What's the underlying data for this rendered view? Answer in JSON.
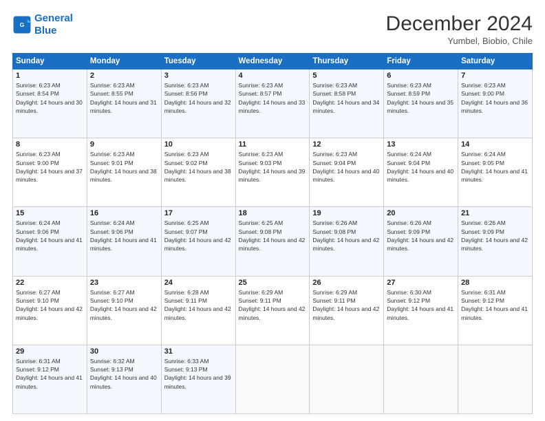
{
  "logo": {
    "line1": "General",
    "line2": "Blue"
  },
  "title": "December 2024",
  "subtitle": "Yumbel, Biobio, Chile",
  "weekdays": [
    "Sunday",
    "Monday",
    "Tuesday",
    "Wednesday",
    "Thursday",
    "Friday",
    "Saturday"
  ],
  "weeks": [
    [
      {
        "day": "1",
        "sunrise": "Sunrise: 6:23 AM",
        "sunset": "Sunset: 8:54 PM",
        "daylight": "Daylight: 14 hours and 30 minutes."
      },
      {
        "day": "2",
        "sunrise": "Sunrise: 6:23 AM",
        "sunset": "Sunset: 8:55 PM",
        "daylight": "Daylight: 14 hours and 31 minutes."
      },
      {
        "day": "3",
        "sunrise": "Sunrise: 6:23 AM",
        "sunset": "Sunset: 8:56 PM",
        "daylight": "Daylight: 14 hours and 32 minutes."
      },
      {
        "day": "4",
        "sunrise": "Sunrise: 6:23 AM",
        "sunset": "Sunset: 8:57 PM",
        "daylight": "Daylight: 14 hours and 33 minutes."
      },
      {
        "day": "5",
        "sunrise": "Sunrise: 6:23 AM",
        "sunset": "Sunset: 8:58 PM",
        "daylight": "Daylight: 14 hours and 34 minutes."
      },
      {
        "day": "6",
        "sunrise": "Sunrise: 6:23 AM",
        "sunset": "Sunset: 8:59 PM",
        "daylight": "Daylight: 14 hours and 35 minutes."
      },
      {
        "day": "7",
        "sunrise": "Sunrise: 6:23 AM",
        "sunset": "Sunset: 9:00 PM",
        "daylight": "Daylight: 14 hours and 36 minutes."
      }
    ],
    [
      {
        "day": "8",
        "sunrise": "Sunrise: 6:23 AM",
        "sunset": "Sunset: 9:00 PM",
        "daylight": "Daylight: 14 hours and 37 minutes."
      },
      {
        "day": "9",
        "sunrise": "Sunrise: 6:23 AM",
        "sunset": "Sunset: 9:01 PM",
        "daylight": "Daylight: 14 hours and 38 minutes."
      },
      {
        "day": "10",
        "sunrise": "Sunrise: 6:23 AM",
        "sunset": "Sunset: 9:02 PM",
        "daylight": "Daylight: 14 hours and 38 minutes."
      },
      {
        "day": "11",
        "sunrise": "Sunrise: 6:23 AM",
        "sunset": "Sunset: 9:03 PM",
        "daylight": "Daylight: 14 hours and 39 minutes."
      },
      {
        "day": "12",
        "sunrise": "Sunrise: 6:23 AM",
        "sunset": "Sunset: 9:04 PM",
        "daylight": "Daylight: 14 hours and 40 minutes."
      },
      {
        "day": "13",
        "sunrise": "Sunrise: 6:24 AM",
        "sunset": "Sunset: 9:04 PM",
        "daylight": "Daylight: 14 hours and 40 minutes."
      },
      {
        "day": "14",
        "sunrise": "Sunrise: 6:24 AM",
        "sunset": "Sunset: 9:05 PM",
        "daylight": "Daylight: 14 hours and 41 minutes."
      }
    ],
    [
      {
        "day": "15",
        "sunrise": "Sunrise: 6:24 AM",
        "sunset": "Sunset: 9:06 PM",
        "daylight": "Daylight: 14 hours and 41 minutes."
      },
      {
        "day": "16",
        "sunrise": "Sunrise: 6:24 AM",
        "sunset": "Sunset: 9:06 PM",
        "daylight": "Daylight: 14 hours and 41 minutes."
      },
      {
        "day": "17",
        "sunrise": "Sunrise: 6:25 AM",
        "sunset": "Sunset: 9:07 PM",
        "daylight": "Daylight: 14 hours and 42 minutes."
      },
      {
        "day": "18",
        "sunrise": "Sunrise: 6:25 AM",
        "sunset": "Sunset: 9:08 PM",
        "daylight": "Daylight: 14 hours and 42 minutes."
      },
      {
        "day": "19",
        "sunrise": "Sunrise: 6:26 AM",
        "sunset": "Sunset: 9:08 PM",
        "daylight": "Daylight: 14 hours and 42 minutes."
      },
      {
        "day": "20",
        "sunrise": "Sunrise: 6:26 AM",
        "sunset": "Sunset: 9:09 PM",
        "daylight": "Daylight: 14 hours and 42 minutes."
      },
      {
        "day": "21",
        "sunrise": "Sunrise: 6:26 AM",
        "sunset": "Sunset: 9:09 PM",
        "daylight": "Daylight: 14 hours and 42 minutes."
      }
    ],
    [
      {
        "day": "22",
        "sunrise": "Sunrise: 6:27 AM",
        "sunset": "Sunset: 9:10 PM",
        "daylight": "Daylight: 14 hours and 42 minutes."
      },
      {
        "day": "23",
        "sunrise": "Sunrise: 6:27 AM",
        "sunset": "Sunset: 9:10 PM",
        "daylight": "Daylight: 14 hours and 42 minutes."
      },
      {
        "day": "24",
        "sunrise": "Sunrise: 6:28 AM",
        "sunset": "Sunset: 9:11 PM",
        "daylight": "Daylight: 14 hours and 42 minutes."
      },
      {
        "day": "25",
        "sunrise": "Sunrise: 6:29 AM",
        "sunset": "Sunset: 9:11 PM",
        "daylight": "Daylight: 14 hours and 42 minutes."
      },
      {
        "day": "26",
        "sunrise": "Sunrise: 6:29 AM",
        "sunset": "Sunset: 9:11 PM",
        "daylight": "Daylight: 14 hours and 42 minutes."
      },
      {
        "day": "27",
        "sunrise": "Sunrise: 6:30 AM",
        "sunset": "Sunset: 9:12 PM",
        "daylight": "Daylight: 14 hours and 41 minutes."
      },
      {
        "day": "28",
        "sunrise": "Sunrise: 6:31 AM",
        "sunset": "Sunset: 9:12 PM",
        "daylight": "Daylight: 14 hours and 41 minutes."
      }
    ],
    [
      {
        "day": "29",
        "sunrise": "Sunrise: 6:31 AM",
        "sunset": "Sunset: 9:12 PM",
        "daylight": "Daylight: 14 hours and 41 minutes."
      },
      {
        "day": "30",
        "sunrise": "Sunrise: 6:32 AM",
        "sunset": "Sunset: 9:13 PM",
        "daylight": "Daylight: 14 hours and 40 minutes."
      },
      {
        "day": "31",
        "sunrise": "Sunrise: 6:33 AM",
        "sunset": "Sunset: 9:13 PM",
        "daylight": "Daylight: 14 hours and 39 minutes."
      },
      null,
      null,
      null,
      null
    ]
  ]
}
